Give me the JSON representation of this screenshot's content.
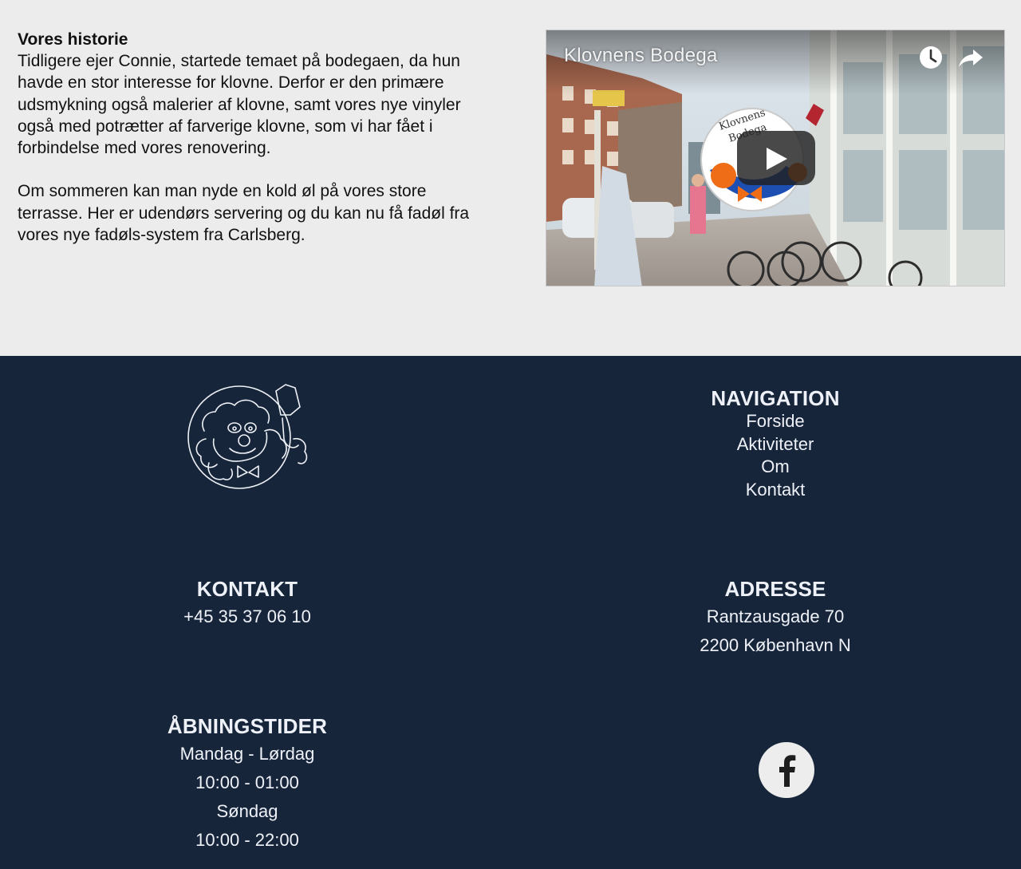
{
  "story": {
    "heading": "Vores historie",
    "paragraphs": [
      "Tidligere ejer Connie, startede temaet på bodegaen, da hun havde en stor interesse for klovne. Derfor er den primære udsmykning også malerier af klovne, samt vores nye vinyler også med potrætter af farverige klovne, som vi har fået i forbindelse med vores renovering.",
      "Om sommeren kan man nyde en kold øl på vores store terrasse. Her er udendørs servering og du kan nu få fadøl fra vores nye fadøls-system fra Carlsberg."
    ]
  },
  "video": {
    "title": "Klovnens Bodega",
    "sign_text_1": "Klovnens",
    "sign_text_2": "Bodega",
    "icons": [
      "clock-icon",
      "share-icon",
      "play-icon"
    ]
  },
  "footer": {
    "logo_icon": "clown-logo-icon",
    "navigation": {
      "heading": "NAVIGATION",
      "links": [
        "Forside",
        "Aktiviteter",
        "Om",
        "Kontakt"
      ]
    },
    "kontakt": {
      "heading": "KONTAKT",
      "phone": "+45 35 37 06 10"
    },
    "adresse": {
      "heading": "ADRESSE",
      "street": "Rantzausgade 70",
      "city": "2200 København N"
    },
    "hours": {
      "heading": "ÅBNINGSTIDER",
      "lines": [
        "Mandag - Lørdag",
        "10:00 - 01:00",
        "Søndag",
        "10:00 - 22:00"
      ]
    },
    "social_icon": "facebook-icon"
  },
  "colors": {
    "page_bg": "#ececec",
    "footer_bg": "#17253a",
    "footer_text": "#eef1f7"
  }
}
